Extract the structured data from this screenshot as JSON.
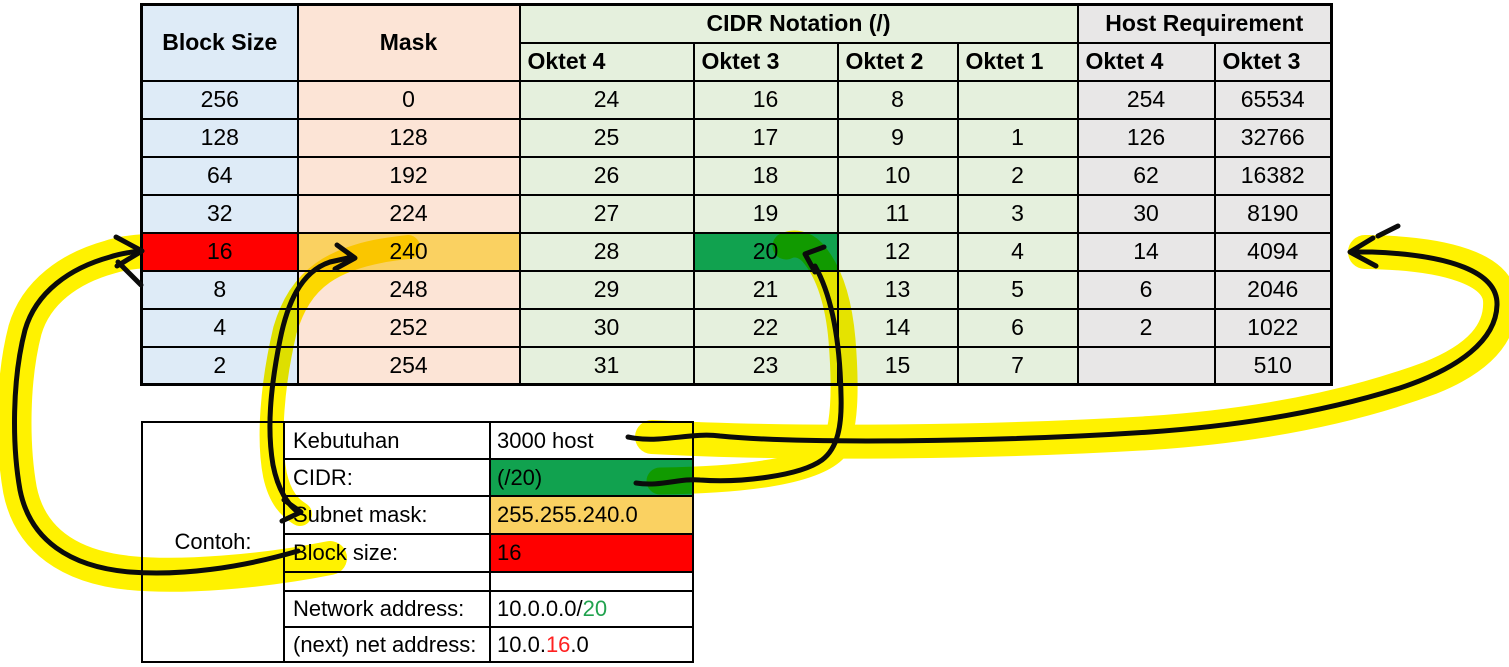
{
  "main_table": {
    "header": {
      "block_size": "Block Size",
      "mask": "Mask",
      "cidr_group": "CIDR Notation (/)",
      "host_group": "Host Requirement",
      "cidr_columns": [
        "Oktet 4",
        "Oktet 3",
        "Oktet 2",
        "Oktet 1"
      ],
      "host_columns": [
        "Oktet 4",
        "Oktet 3"
      ]
    },
    "rows": [
      [
        "256",
        "0",
        "24",
        "16",
        "8",
        "",
        "254",
        "65534"
      ],
      [
        "128",
        "128",
        "25",
        "17",
        "9",
        "1",
        "126",
        "32766"
      ],
      [
        "64",
        "192",
        "26",
        "18",
        "10",
        "2",
        "62",
        "16382"
      ],
      [
        "32",
        "224",
        "27",
        "19",
        "11",
        "3",
        "30",
        "8190"
      ],
      [
        "16",
        "240",
        "28",
        "20",
        "12",
        "4",
        "14",
        "4094"
      ],
      [
        "8",
        "248",
        "29",
        "21",
        "13",
        "5",
        "6",
        "2046"
      ],
      [
        "4",
        "252",
        "30",
        "22",
        "14",
        "6",
        "2",
        "1022"
      ],
      [
        "2",
        "254",
        "31",
        "23",
        "15",
        "7",
        "",
        "510"
      ]
    ],
    "highlighted_cells": {
      "4": {
        "0": "red",
        "1": "gold",
        "3": "green"
      }
    }
  },
  "example_table": {
    "caption": "Contoh:",
    "rows": [
      {
        "label": "Kebutuhan",
        "value": "3000 host",
        "value_bg": "none"
      },
      {
        "label": "CIDR:",
        "value": "(/20)",
        "value_bg": "green"
      },
      {
        "label": "Subnet mask:",
        "value": "255.255.240.0",
        "value_bg": "gold"
      },
      {
        "label": "Block size:",
        "value": "16",
        "value_bg": "red"
      },
      {
        "label": "",
        "value": "",
        "value_bg": "none"
      },
      {
        "label": "Network address:",
        "value_bg": "none",
        "value_parts": [
          {
            "text": "10.0.0.0/",
            "color": "default"
          },
          {
            "text": "20",
            "color": "green"
          }
        ]
      },
      {
        "label": "(next) net address:",
        "value_bg": "none",
        "value_parts": [
          {
            "text": "10.0.",
            "color": "default"
          },
          {
            "text": "16",
            "color": "red"
          },
          {
            "text": ".0",
            "color": "default"
          }
        ]
      }
    ]
  },
  "annotations": {
    "arrows": [
      "block-size-16-loop-arrow",
      "subnet-mask-to-240-arrow",
      "cidr-20-to-oktet3-20-arrow",
      "3000-host-to-4094-arrow"
    ]
  },
  "colors": {
    "column_blue": "#DEEBF7",
    "column_peach": "#FCE4D6",
    "column_green": "#E5F0DD",
    "column_gray": "#E8E7E7",
    "highlight_red": "#FF0000",
    "highlight_gold": "#FAD161",
    "highlight_green": "#11A24F",
    "pen_black": "#0B0B0B",
    "marker_yellow": "#FFF200",
    "text_green": "#21A24E",
    "text_red": "#FF2121"
  }
}
